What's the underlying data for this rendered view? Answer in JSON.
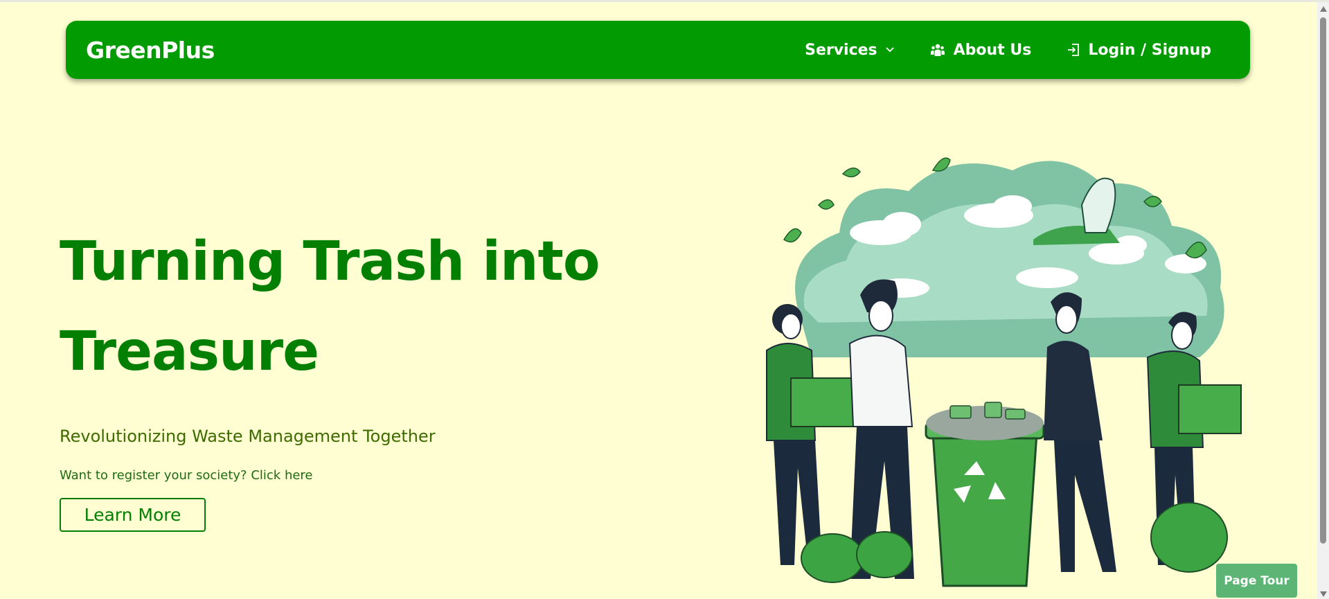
{
  "navbar": {
    "brand": "GreenPlus",
    "services_label": "Services",
    "about_label": "About Us",
    "login_label": "Login / Signup",
    "icons": {
      "services": "chevron-down-icon",
      "about": "people-icon",
      "login": "login-icon"
    }
  },
  "hero": {
    "title_line1": "Turning Trash into",
    "title_line2": "Treasure",
    "subtitle": "Revolutionizing Waste Management Together",
    "register_text": "Want to register your society? Click here",
    "learn_more_label": "Learn More"
  },
  "illustration": {
    "description_icon": "people-recycling-illustration"
  },
  "page_tour": {
    "label": "Page Tour"
  },
  "colors": {
    "background": "#fffed2",
    "navbar": "#029b02",
    "heading": "#038003",
    "subtitle": "#3d6b00",
    "tour_button": "#5cb574"
  }
}
